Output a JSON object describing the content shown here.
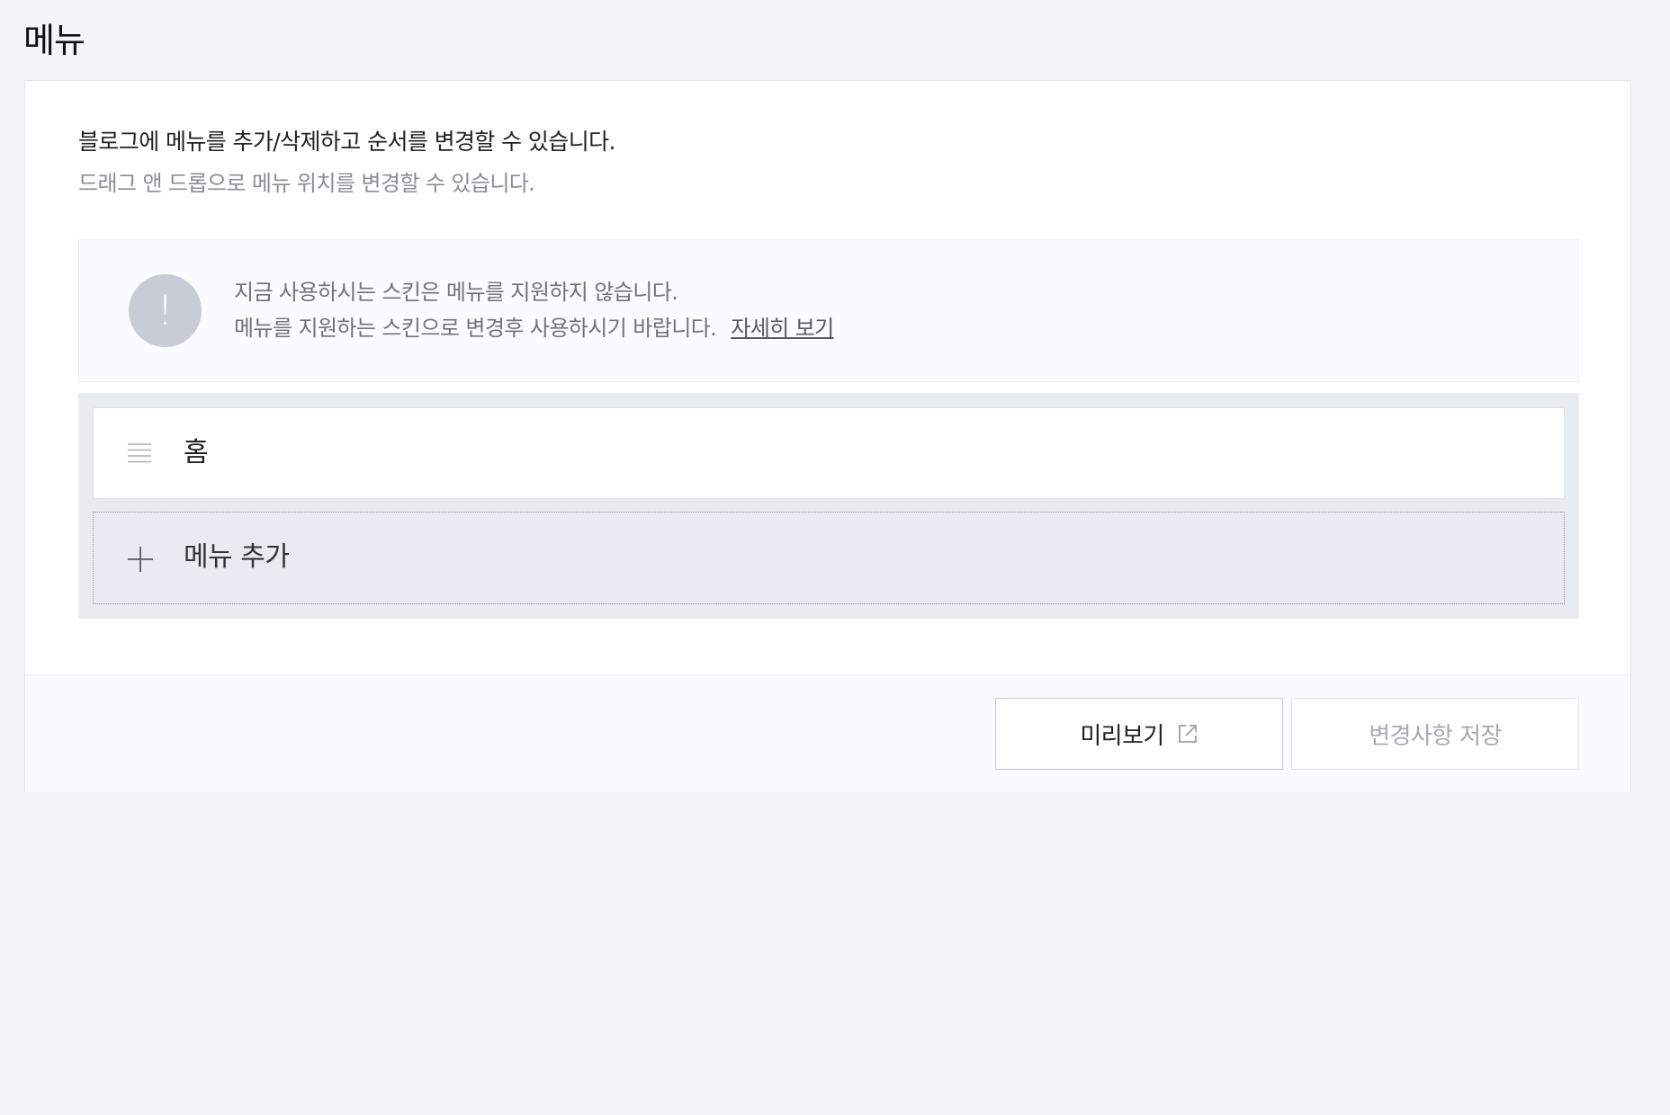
{
  "page": {
    "title": "메뉴"
  },
  "intro": {
    "main": "블로그에 메뉴를 추가/삭제하고 순서를 변경할 수 있습니다.",
    "sub": "드래그 앤 드롭으로 메뉴 위치를 변경할 수 있습니다."
  },
  "notice": {
    "icon": "exclamation-icon",
    "icon_glyph": "!",
    "line1": "지금 사용하시는 스킨은 메뉴를 지원하지 않습니다.",
    "line2": "메뉴를 지원하는 스킨으로 변경후 사용하시기 바랍니다.",
    "link_label": "자세히 보기"
  },
  "menu_list": {
    "items": [
      {
        "label": "홈",
        "icon": "drag-handle-icon"
      }
    ],
    "add_label": "메뉴 추가",
    "add_icon": "plus-icon"
  },
  "footer": {
    "preview_label": "미리보기",
    "preview_icon": "external-link-icon",
    "save_label": "변경사항 저장"
  },
  "colors": {
    "page_background": "#f4f5f7",
    "panel_background": "#ffffff",
    "list_background": "#e8ebf0",
    "notice_icon": "#c7ccd6",
    "disabled_text": "#a6aab2"
  }
}
